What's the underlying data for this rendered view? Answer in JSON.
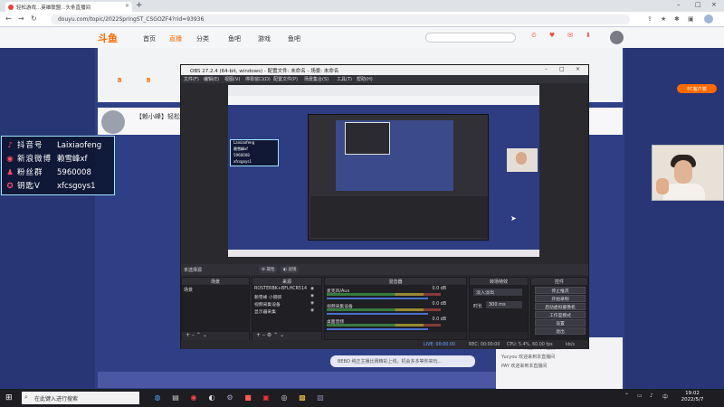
{
  "browser": {
    "tab_title": "轻松游戏...英雄联盟...头条直播间",
    "url": "douyu.com/topic/2022SpringST_CSGOZF4?rid=93936"
  },
  "site": {
    "nav": [
      "首页",
      "直播",
      "分类",
      "鱼吧",
      "游戏",
      "鱼吧"
    ],
    "stream_title": "【赖小峰】轻松...",
    "stat1": "8",
    "stat2": "8",
    "banner_text": "BEBO 纯正主播比赛精彩上线，机会多多等你来玩..."
  },
  "overlay": {
    "rows": [
      {
        "icon": "♪",
        "label": "抖音号",
        "value": "Laixiaofeng"
      },
      {
        "icon": "◉",
        "label": "新浪微博",
        "value": "赖雪峰xf"
      },
      {
        "icon": "♟",
        "label": "粉丝群",
        "value": "5960008"
      },
      {
        "icon": "✪",
        "label": "钥匙V",
        "value": "xfcsgoys1"
      }
    ]
  },
  "obs": {
    "title": "OBS 27.2.4 (64-bit, windows) - 配置文件: 未命名 - 场景: 未命名",
    "menu": [
      "文件(F)",
      "编辑(E)",
      "视图(V)",
      "停靠窗口(D)",
      "配置文件(P)",
      "场景集合(S)",
      "工具(T)",
      "帮助(H)"
    ],
    "no_source": "未选择源",
    "props_btn": "属性",
    "filter_btn": "滤镜",
    "docks": {
      "scenes": "场景",
      "sources": "来源",
      "mixer": "混音器",
      "transitions": "转场特效",
      "controls": "控件"
    },
    "scene_item": "场景",
    "sources": [
      "ROSTERBK+BFLHCR514",
      "赖雪峰 小钢侠",
      "视频采集设备",
      "显示器采集"
    ],
    "mixer": [
      {
        "name": "麦克风/Aux",
        "db": "0.0 dB"
      },
      {
        "name": "视频采集设备",
        "db": "0.0 dB"
      },
      {
        "name": "桌面音频",
        "db": "0.0 dB"
      }
    ],
    "transition_name": "淡入淡出",
    "duration_label": "时长",
    "duration_value": "300 ms",
    "controls": [
      "停止推流",
      "开始录制",
      "启动虚拟摄像机",
      "工作室模式",
      "设置",
      "退出"
    ],
    "status": {
      "live": "LIVE: 00:00:00",
      "rec": "REC: 00:00:00",
      "cpu": "CPU: 5.4%, 60.00 fps",
      "kb": "kb/s"
    }
  },
  "taskbar": {
    "search_placeholder": "在此键入进行搜索",
    "time": "19:02",
    "date": "2022/5/7"
  },
  "colors": {
    "accent": "#ff6a00",
    "page_bg": "#2f3f86",
    "obs_bg": "#2a2a2e",
    "overlay_border": "#9fe6ff"
  }
}
